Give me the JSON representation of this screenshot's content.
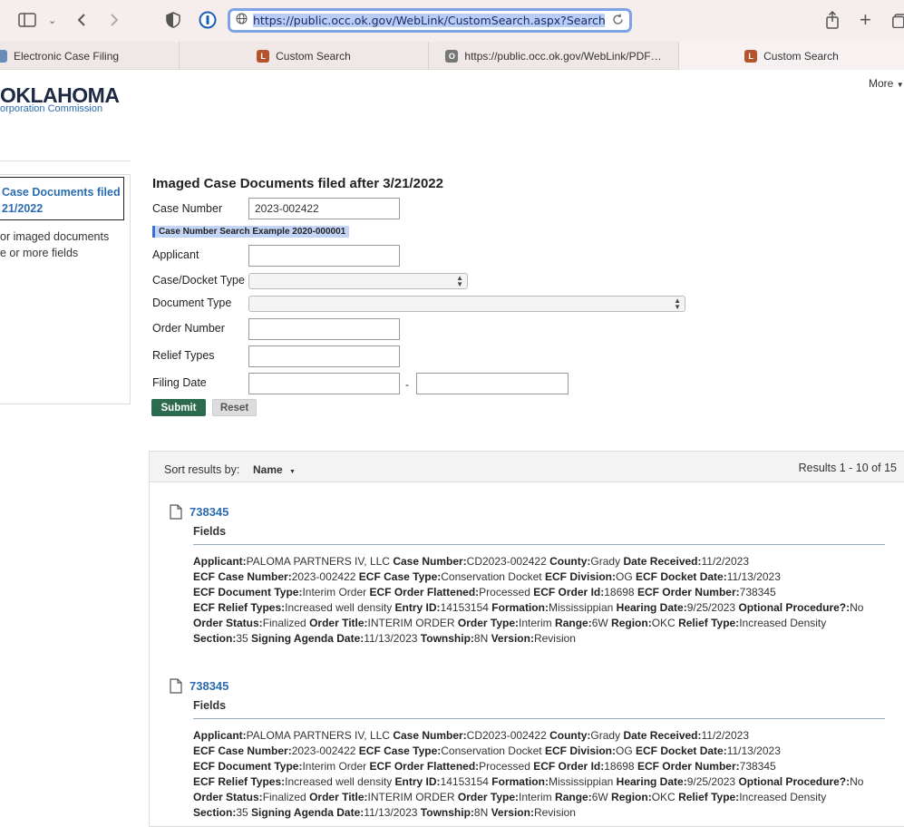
{
  "browser": {
    "url": "https://public.occ.ok.gov/WebLink/CustomSearch.aspx?SearchNa",
    "tabs": [
      {
        "label": "Electronic Case Filing"
      },
      {
        "label": "Custom Search"
      },
      {
        "label": "https://public.occ.ok.gov/WebLink/PDF…"
      },
      {
        "label": "Custom Search"
      }
    ]
  },
  "header": {
    "logo_line1": "OKLAHOMA",
    "logo_line2": "orporation Commission",
    "more": "More"
  },
  "sidebar": {
    "link": "Case Documents filed 21/2022",
    "link_line1": "Case Documents filed",
    "link_line2": "21/2022",
    "text_line1": "or imaged documents",
    "text_line2": "e or more fields"
  },
  "form": {
    "title": "Imaged Case Documents filed after 3/21/2022",
    "case_number_label": "Case Number",
    "case_number_value": "2023-002422",
    "example": "Case Number Search Example 2020-000001",
    "applicant_label": "Applicant",
    "case_docket_type_label": "Case/Docket Type",
    "document_type_label": "Document Type",
    "order_number_label": "Order Number",
    "relief_types_label": "Relief Types",
    "filing_date_label": "Filing Date",
    "date_separator": "-",
    "submit": "Submit",
    "reset": "Reset"
  },
  "results": {
    "sort_label": "Sort results by:",
    "sort_value": "Name",
    "count": "Results  1 - 10 of 15",
    "fields_label": "Fields",
    "entries": [
      {
        "title": "738345",
        "applicant": "PALOMA PARTNERS IV, LLC",
        "case_number": "CD2023-002422",
        "county": "Grady",
        "date_received": "11/2/2023",
        "ecf_case_number": "2023-002422",
        "ecf_case_type": "Conservation Docket",
        "ecf_division": "OG",
        "ecf_docket_date": "11/13/2023",
        "ecf_document_type": "Interim Order",
        "ecf_order_flattened": "Processed",
        "ecf_order_id": "18698",
        "ecf_order_number": "738345",
        "ecf_relief_types": "Increased well density",
        "entry_id": "14153154",
        "formation": "Mississippian",
        "hearing_date": "9/25/2023",
        "optional_procedure": "No",
        "order_status": "Finalized",
        "order_title": "INTERIM ORDER",
        "order_type": "Interim",
        "range": "6W",
        "region": "OKC",
        "relief_type": "Increased Density",
        "section": "35",
        "signing_agenda_date": "11/13/2023",
        "township": "8N",
        "version": "Revision"
      },
      {
        "title": "738345",
        "applicant": "PALOMA PARTNERS IV, LLC",
        "case_number": "CD2023-002422",
        "county": "Grady",
        "date_received": "11/2/2023",
        "ecf_case_number": "2023-002422",
        "ecf_case_type": "Conservation Docket",
        "ecf_division": "OG",
        "ecf_docket_date": "11/13/2023",
        "ecf_document_type": "Interim Order",
        "ecf_order_flattened": "Processed",
        "ecf_order_id": "18698",
        "ecf_order_number": "738345",
        "ecf_relief_types": "Increased well density",
        "entry_id": "14153154",
        "formation": "Mississippian",
        "hearing_date": "9/25/2023",
        "optional_procedure": "No",
        "order_status": "Finalized",
        "order_title": "INTERIM ORDER",
        "order_type": "Interim",
        "range": "6W",
        "region": "OKC",
        "relief_type": "Increased Density",
        "section": "35",
        "signing_agenda_date": "11/13/2023",
        "township": "8N",
        "version": "Revision"
      }
    ],
    "field_labels": {
      "applicant": "Applicant:",
      "case_number": "Case Number:",
      "county": "County:",
      "date_received": "Date Received:",
      "ecf_case_number": "ECF Case Number:",
      "ecf_case_type": "ECF Case Type:",
      "ecf_division": "ECF Division:",
      "ecf_docket_date": "ECF Docket Date:",
      "ecf_document_type": "ECF Document Type:",
      "ecf_order_flattened": "ECF Order Flattened:",
      "ecf_order_id": "ECF Order Id:",
      "ecf_order_number": "ECF Order Number:",
      "ecf_relief_types": "ECF Relief Types:",
      "entry_id": "Entry ID:",
      "formation": "Formation:",
      "hearing_date": "Hearing Date:",
      "optional_procedure": "Optional Procedure?:",
      "order_status": "Order Status:",
      "order_title": "Order Title:",
      "order_type": "Order Type:",
      "range": "Range:",
      "region": "Region:",
      "relief_type": "Relief Type:",
      "section": "Section:",
      "signing_agenda_date": "Signing Agenda Date:",
      "township": "Township:",
      "version": "Version:"
    }
  },
  "icons": {
    "sidebar": "sidebar-icon",
    "back": "back-arrow-icon",
    "forward": "forward-arrow-icon",
    "shield": "shield-icon",
    "password": "password-manager-icon",
    "globe": "globe-icon",
    "reload": "reload-icon",
    "share": "share-icon",
    "new_tab": "plus-icon",
    "tabs": "tab-overview-icon",
    "document": "document-icon"
  }
}
